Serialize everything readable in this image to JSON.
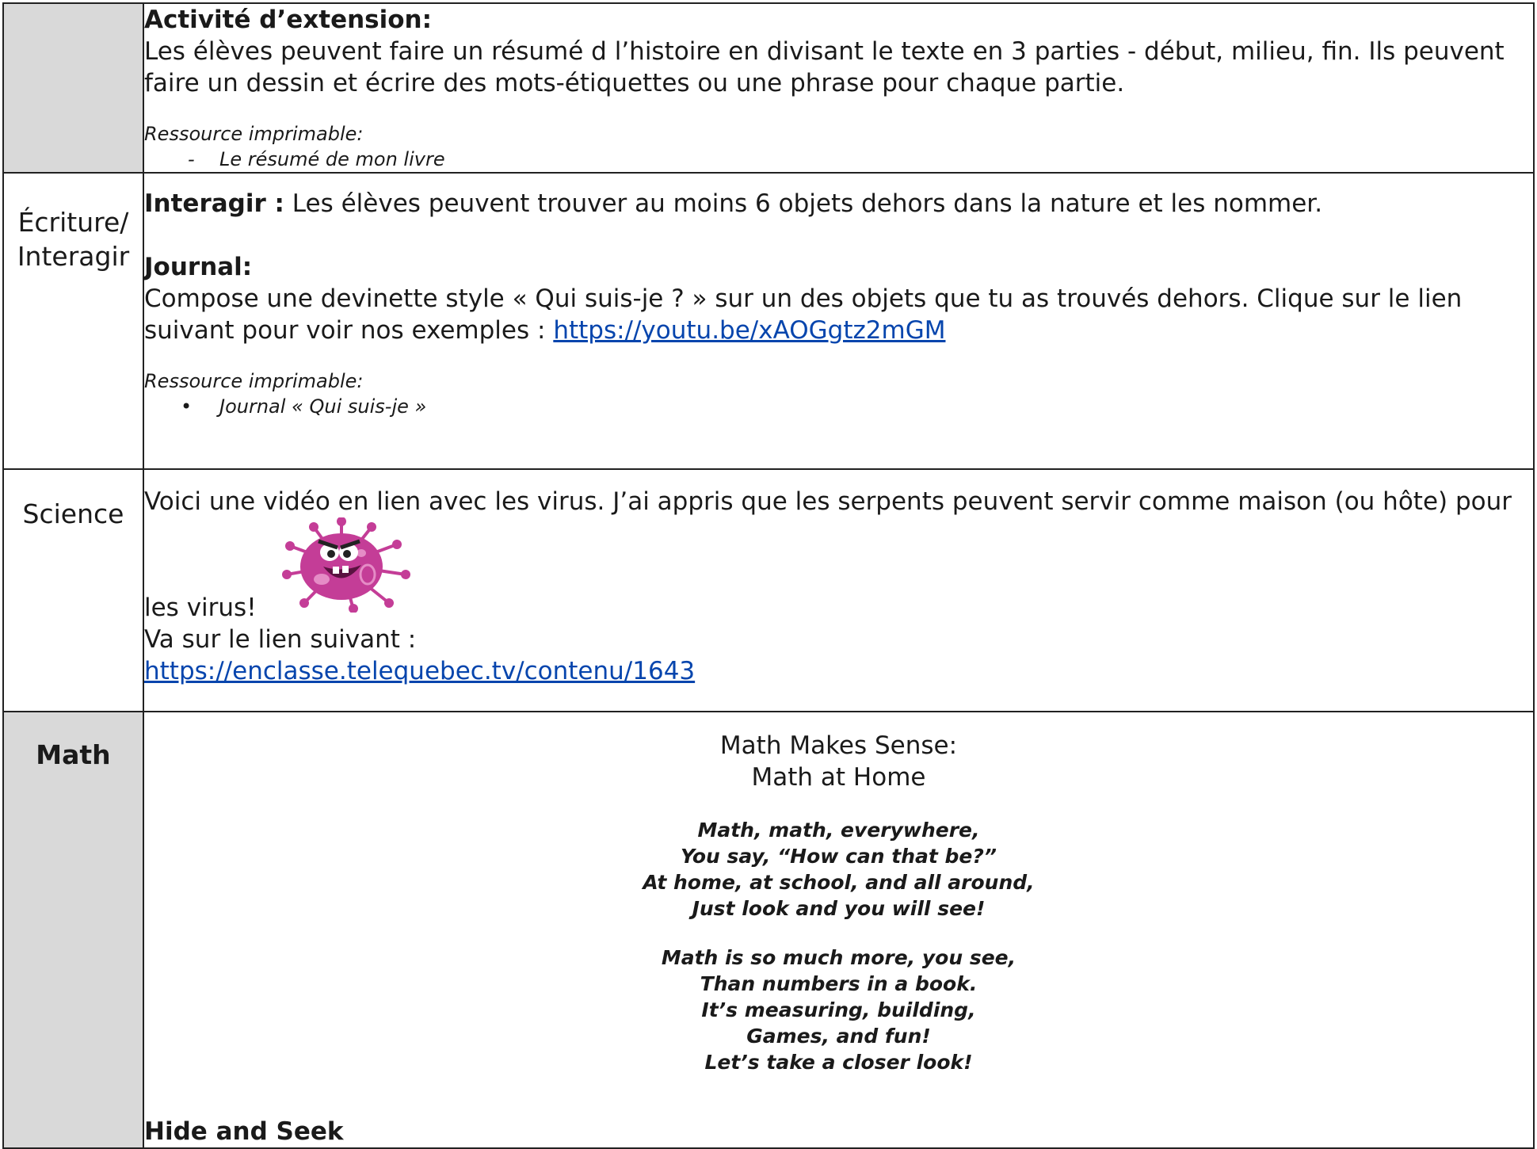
{
  "extension": {
    "heading": "Activité d’extension:",
    "text": "Les élèves peuvent faire un résumé d l’histoire en divisant le texte en 3 parties - début, milieu, fin. Ils peuvent faire un dessin et écrire des mots-étiquettes ou une phrase pour chaque partie.",
    "resource_label": "Ressource imprimable:",
    "resource_item": "Le résumé de mon livre"
  },
  "ecriture": {
    "subject_line1": "Écriture/",
    "subject_line2": "Interagir",
    "interagir_label": "Interagir :",
    "interagir_text": " Les élèves peuvent trouver au moins 6 objets dehors dans la nature et les nommer.",
    "journal_label": "Journal:",
    "journal_text": "Compose une devinette style « Qui suis-je ? » sur un des objets que tu as trouvés dehors. Clique sur le lien suivant pour voir nos exemples : ",
    "journal_link": "https://youtu.be/xAOGgtz2mGM",
    "resource_label": "Ressource imprimable:",
    "resource_item": "Journal « Qui suis-je »"
  },
  "science": {
    "subject": "Science",
    "text": "Voici une vidéo en lien avec les virus. J’ai appris que les serpents peuvent servir comme maison (ou hôte) pour",
    "text_end": "les virus!",
    "link_intro": "Va sur le lien suivant :",
    "link": "https://enclasse.telequebec.tv/contenu/1643",
    "image_icon": "virus-cartoon-icon"
  },
  "math": {
    "subject": "Math",
    "title_line1": "Math Makes Sense:",
    "title_line2": "Math at Home",
    "poem_stanza1": [
      "Math, math, everywhere,",
      "You say, “How can that be?”",
      "At home, at school, and all around,",
      "Just look and you will see!"
    ],
    "poem_stanza2": [
      "Math is so much more, you see,",
      "Than numbers in a book.",
      "It’s measuring, building,",
      "Games, and fun!",
      "Let’s take a closer look!"
    ],
    "activity_heading": "Hide and Seek"
  },
  "colors": {
    "subject_bg": "#d9d9d9",
    "link": "#0645ad",
    "virus": "#c43d97"
  }
}
